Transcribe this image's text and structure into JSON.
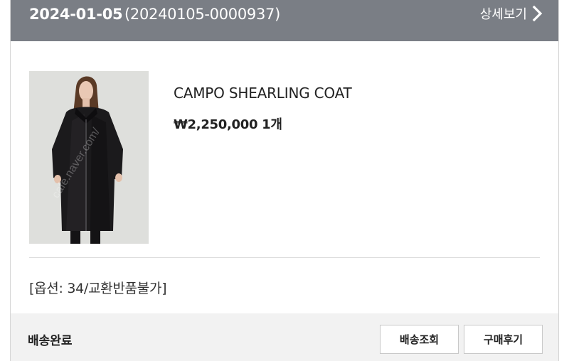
{
  "header": {
    "date": "2024-01-05",
    "order_number": "(20240105-0000937)",
    "detail_label": "상세보기"
  },
  "product": {
    "name": "CAMPO SHEARLING COAT",
    "price": "₩2,250,000",
    "quantity": "1개",
    "option": "[옵션: 34/교환반품불가]",
    "image_icon": "coat-photo"
  },
  "footer": {
    "status": "배송완료",
    "track_label": "배송조회",
    "review_label": "구매후기"
  },
  "colors": {
    "header_bg": "#7a7e85",
    "footer_bg": "#f2f2f2"
  }
}
